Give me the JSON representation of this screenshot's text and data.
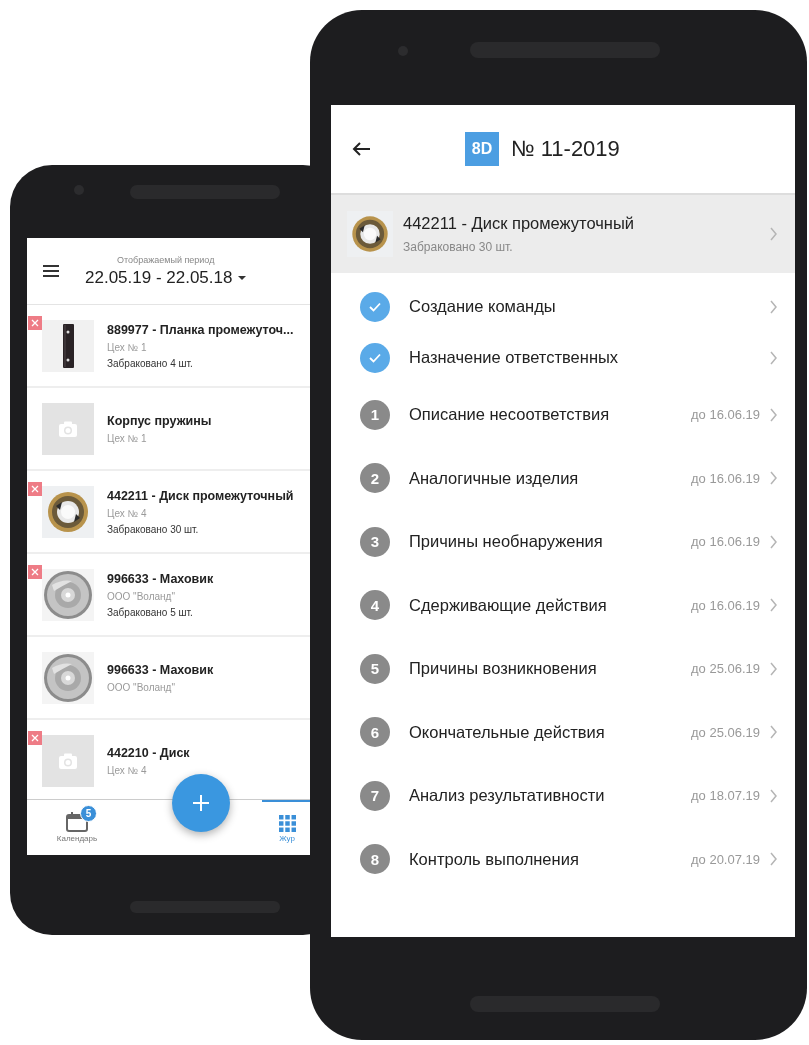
{
  "journal": {
    "period_label": "Отображаемый период",
    "period": "22.05.19 - 22.05.18",
    "items": [
      {
        "title": "889977 - Планка промежуточ...",
        "source": "Цех № 1",
        "rejected": "Забраковано 4 шт.",
        "flagged": true,
        "kind": "picture"
      },
      {
        "title": "Корпус пружины",
        "source": "Цех № 1",
        "flagged": false,
        "kind": "placeholder"
      },
      {
        "title": "442211 - Диск промежуточный",
        "source": "Цех № 4",
        "rejected": "Забраковано 30 шт.",
        "flagged": true,
        "kind": "picture"
      },
      {
        "title": "996633 - Маховик",
        "source": "ООО \"Воланд\"",
        "rejected": "Забраковано 5 шт.",
        "flagged": true,
        "kind": "picture"
      },
      {
        "title": "996633 - Маховик",
        "source": "ООО \"Воланд\"",
        "flagged": false,
        "kind": "picture"
      },
      {
        "title": "442210 - Диск",
        "source": "Цех № 4",
        "flagged": true,
        "kind": "placeholder"
      }
    ],
    "nav": [
      {
        "kind": "calendar",
        "label": "Календарь",
        "badge": "5",
        "selected": false
      },
      {
        "kind": "grid",
        "label": "Жур",
        "selected": true
      }
    ]
  },
  "report": {
    "badge": "8D",
    "title": "№ 11-2019",
    "product": {
      "title": "442211 - Диск промежуточный",
      "rejected": "Забраковано 30 шт.",
      "kind": "picture"
    },
    "steps": [
      {
        "kind": "done",
        "label": "Создание команды"
      },
      {
        "kind": "done",
        "label": "Назначение ответственных"
      },
      {
        "kind": "number",
        "number": "1",
        "label": "Описание несоответствия",
        "due": "до 16.06.19"
      },
      {
        "kind": "number",
        "number": "2",
        "label": "Аналогичные изделия",
        "due": "до 16.06.19"
      },
      {
        "kind": "number",
        "number": "3",
        "label": "Причины необнаружения",
        "due": "до 16.06.19"
      },
      {
        "kind": "number",
        "number": "4",
        "label": "Сдерживающие действия",
        "due": "до 16.06.19"
      },
      {
        "kind": "number",
        "number": "5",
        "label": "Причины возникновения",
        "due": "до 25.06.19"
      },
      {
        "kind": "number",
        "number": "6",
        "label": "Окончательные действия",
        "due": "до 25.06.19"
      },
      {
        "kind": "number",
        "number": "7",
        "label": "Анализ результативности",
        "due": "до 18.07.19"
      },
      {
        "kind": "number",
        "number": "8",
        "label": "Контроль выполнения",
        "due": "до 20.07.19"
      }
    ]
  }
}
